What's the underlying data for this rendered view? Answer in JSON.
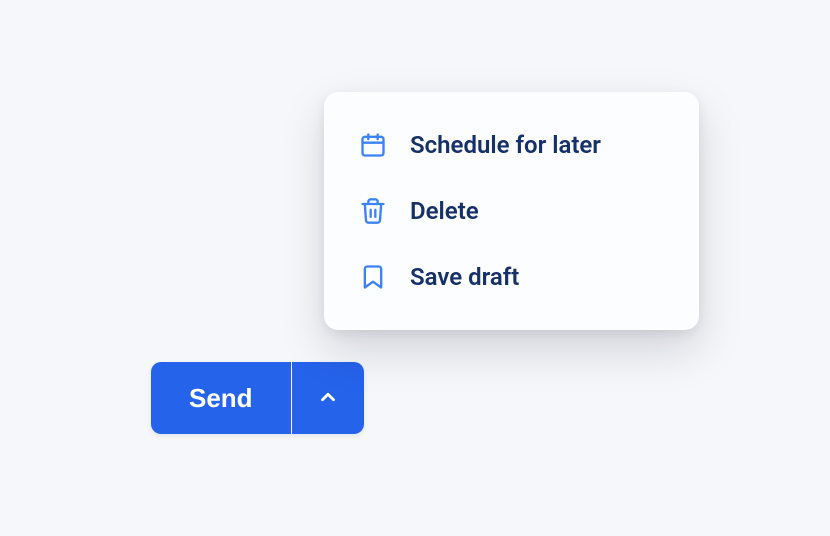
{
  "button": {
    "send_label": "Send"
  },
  "menu": {
    "items": [
      {
        "icon": "calendar-icon",
        "label": "Schedule for later"
      },
      {
        "icon": "trash-icon",
        "label": "Delete"
      },
      {
        "icon": "bookmark-icon",
        "label": "Save draft"
      }
    ]
  },
  "colors": {
    "primary": "#2563eb",
    "icon": "#3b82f6",
    "text": "#163069",
    "background": "#f5f7fa",
    "menu_bg": "#fcfdff"
  }
}
